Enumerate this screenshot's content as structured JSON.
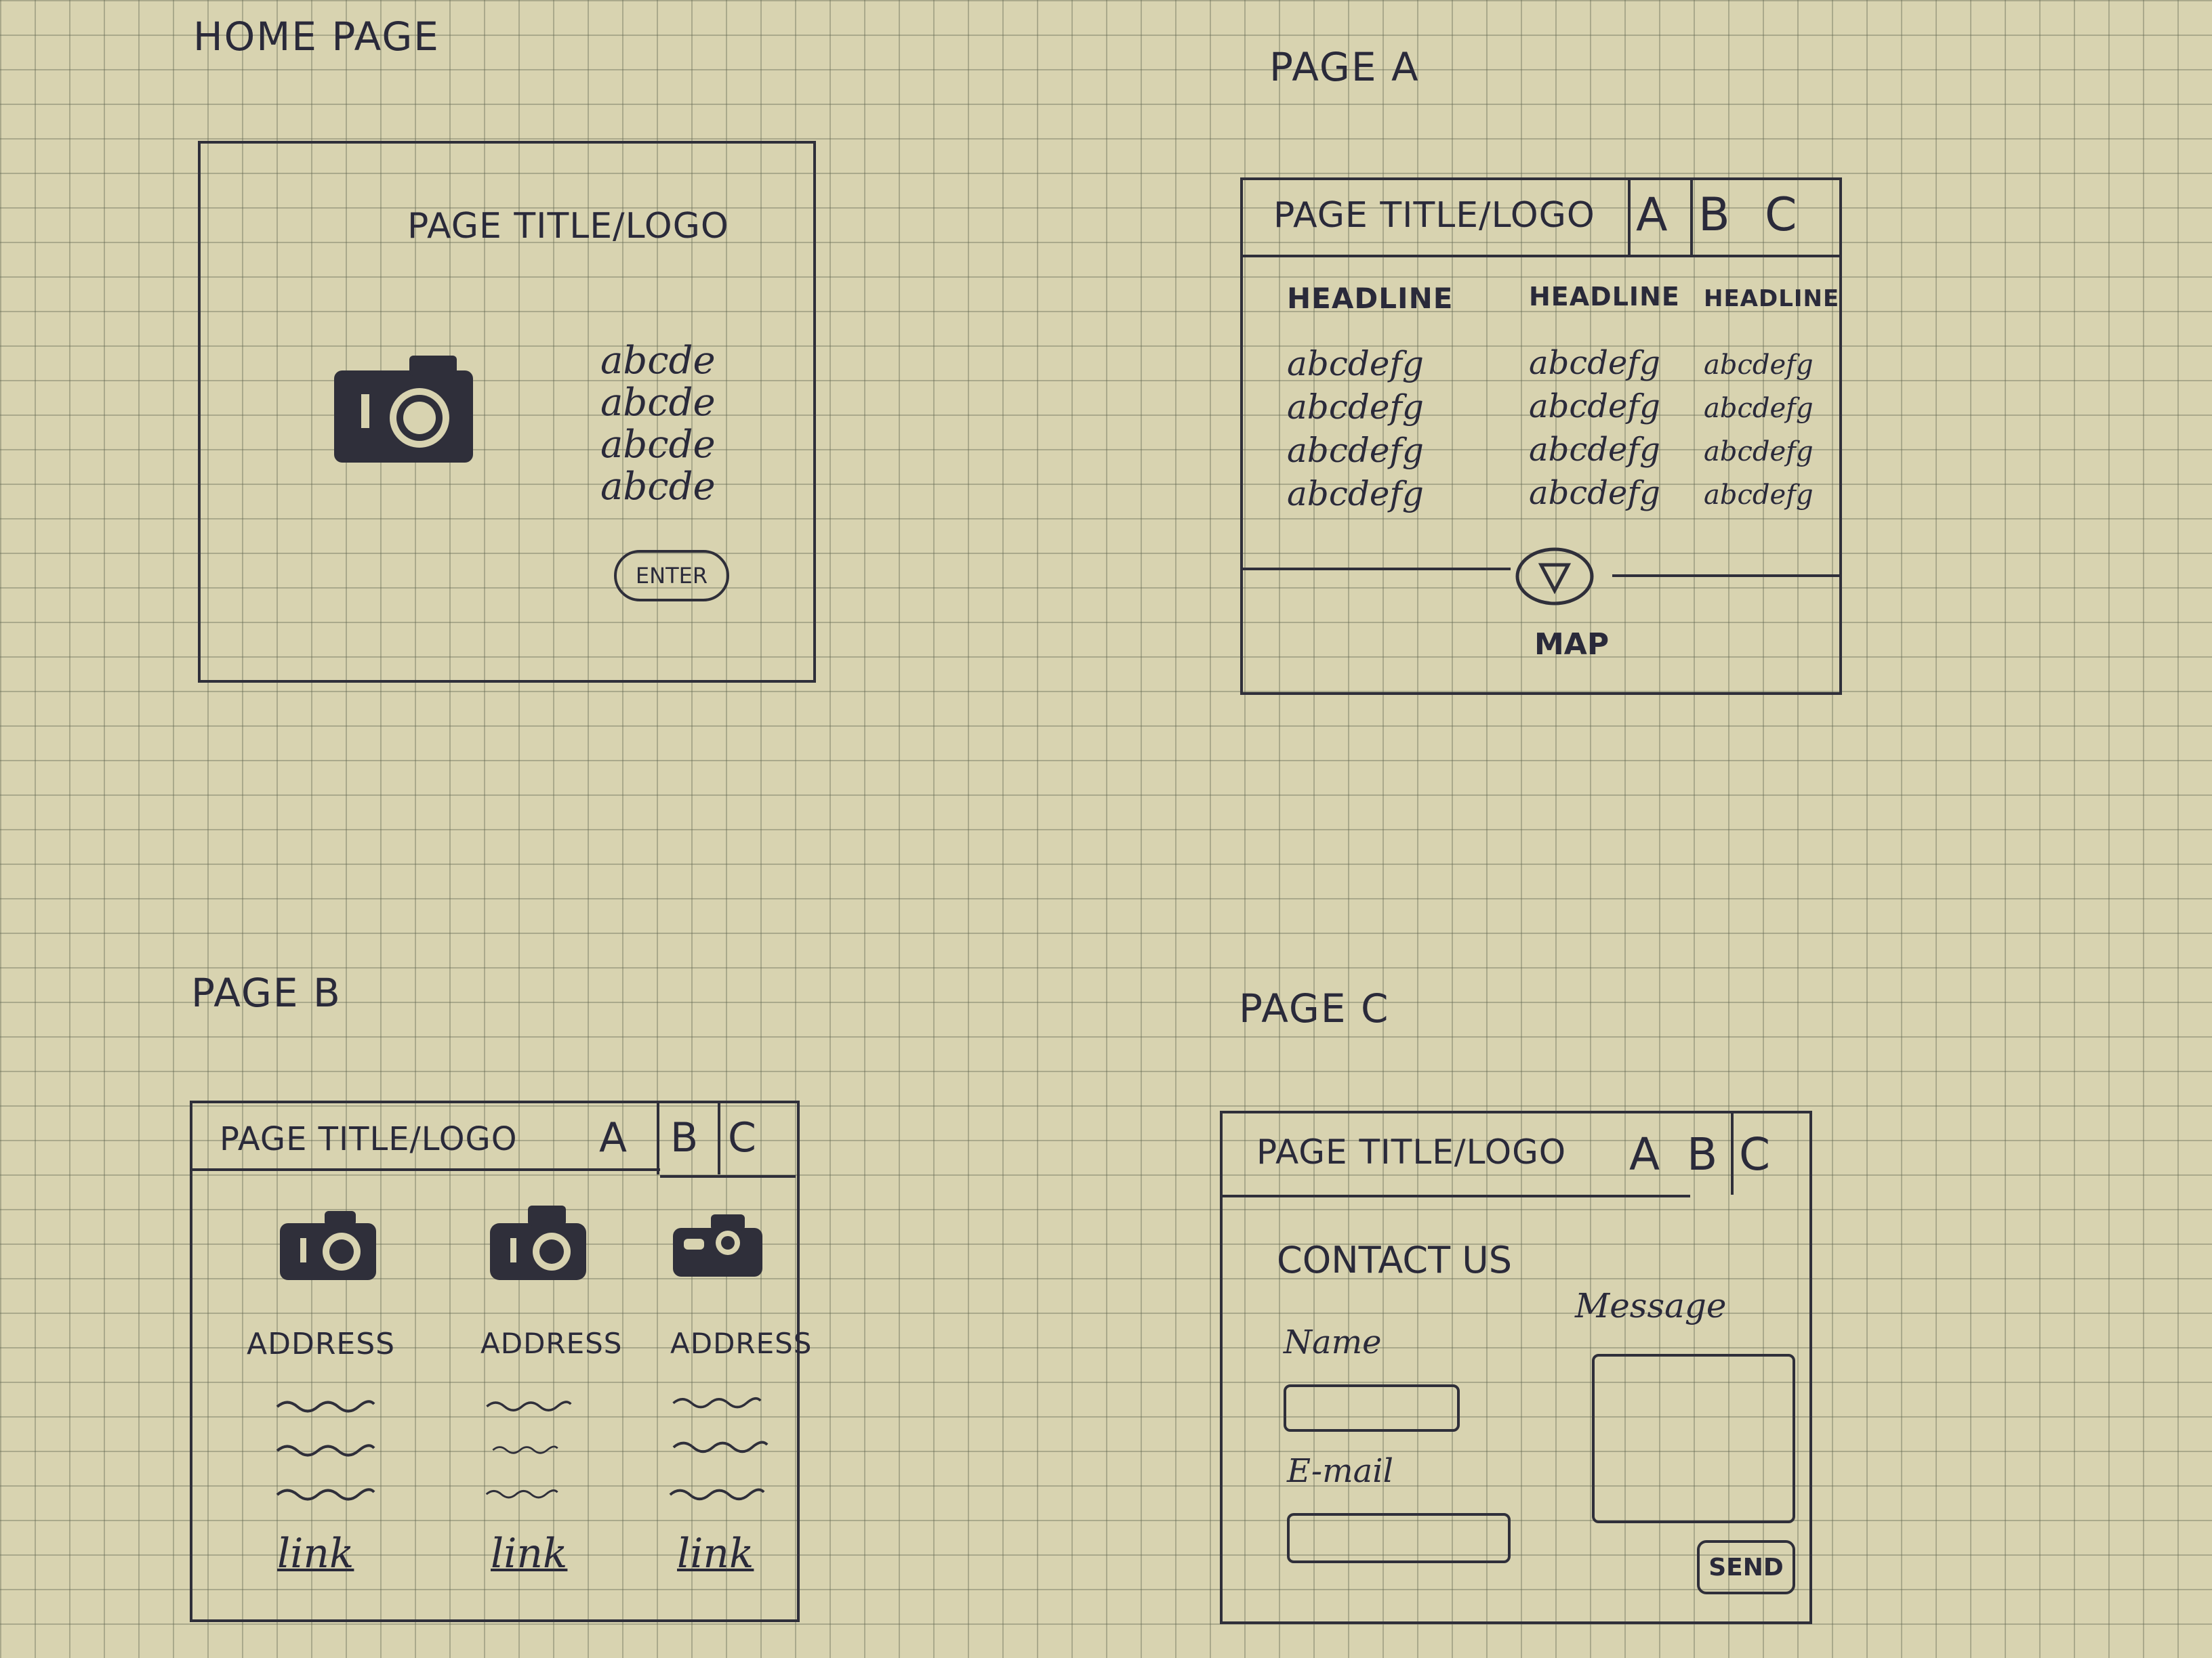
{
  "home": {
    "caption": "HOME PAGE",
    "title": "PAGE TITLE/LOGO",
    "text_lines": [
      "abcde",
      "abcde",
      "abcde",
      "abcde"
    ],
    "enter_label": "ENTER",
    "icon": "camera-icon"
  },
  "page_a": {
    "caption": "PAGE A",
    "title": "PAGE TITLE/LOGO",
    "nav": [
      "A",
      "B",
      "C"
    ],
    "columns": [
      {
        "headline": "HEADLINE",
        "lines": [
          "abcdefg",
          "abcdefg",
          "abcdefg",
          "abcdefg"
        ]
      },
      {
        "headline": "HEADLINE",
        "lines": [
          "abcdefg",
          "abcdefg",
          "abcdefg",
          "abcdefg"
        ]
      },
      {
        "headline": "HEADLINE",
        "lines": [
          "abcdefg",
          "abcdefg",
          "abcdefg",
          "abcdefg"
        ]
      }
    ],
    "map_label": "MAP",
    "icon": "chevron-down-icon"
  },
  "page_b": {
    "caption": "PAGE B",
    "title": "PAGE TITLE/LOGO",
    "nav": [
      "A",
      "B",
      "C"
    ],
    "cards": [
      {
        "address": "ADDRESS",
        "link": "link"
      },
      {
        "address": "ADDRESS",
        "link": "link"
      },
      {
        "address": "ADDRESS",
        "link": "link"
      }
    ]
  },
  "page_c": {
    "caption": "PAGE C",
    "title": "PAGE TITLE/LOGO",
    "nav": [
      "A",
      "B",
      "C"
    ],
    "heading": "CONTACT US",
    "name_label": "Name",
    "email_label": "E-mail",
    "message_label": "Message",
    "send_label": "SEND"
  },
  "colors": {
    "paper": "#d8d3b0",
    "grid": "#5f6450",
    "ink": "#2a2a3a"
  }
}
